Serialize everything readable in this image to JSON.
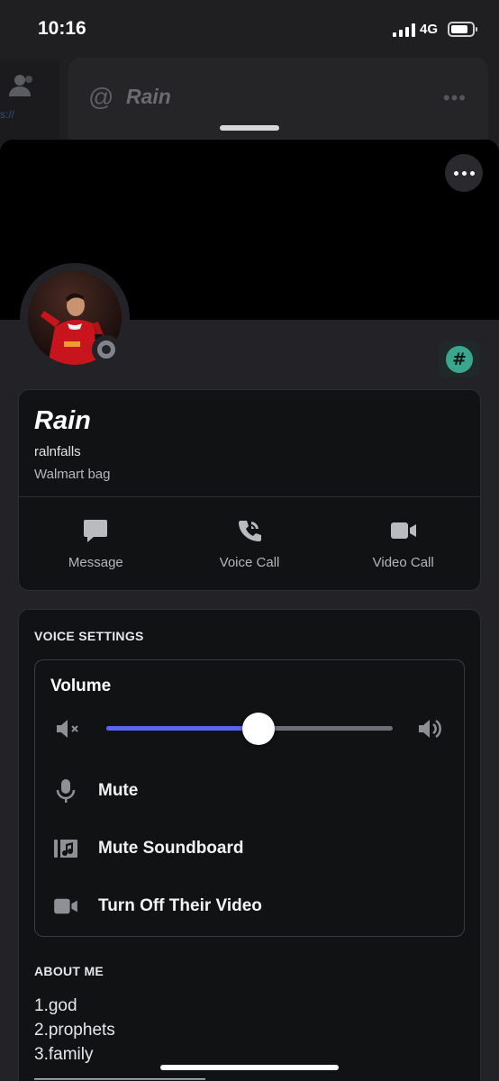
{
  "status_bar": {
    "time": "10:16",
    "network": "4G"
  },
  "background": {
    "channel_prefix": "@",
    "channel_name": "Rain",
    "link_fragment": "s://"
  },
  "profile": {
    "display_name": "Rain",
    "username": "ralnfalls",
    "custom_status": "Walmart bag",
    "badge_symbol": "#",
    "actions": [
      {
        "label": "Message",
        "icon": "chat-bubble-icon"
      },
      {
        "label": "Voice Call",
        "icon": "phone-icon"
      },
      {
        "label": "Video Call",
        "icon": "video-camera-icon"
      }
    ]
  },
  "voice_settings": {
    "heading": "VOICE SETTINGS",
    "volume_label": "Volume",
    "volume_fraction": 0.53,
    "accent_color": "#5865f2",
    "items": [
      {
        "label": "Mute",
        "icon": "microphone-icon"
      },
      {
        "label": "Mute Soundboard",
        "icon": "soundboard-icon"
      },
      {
        "label": "Turn Off Their Video",
        "icon": "video-camera-icon"
      }
    ]
  },
  "about_me": {
    "heading": "ABOUT ME",
    "lines": [
      "1.god",
      "2.prophets",
      "3.family",
      "——————————"
    ]
  },
  "colors": {
    "background": "#232327",
    "card": "#111214",
    "badge": "#3ba58e"
  }
}
